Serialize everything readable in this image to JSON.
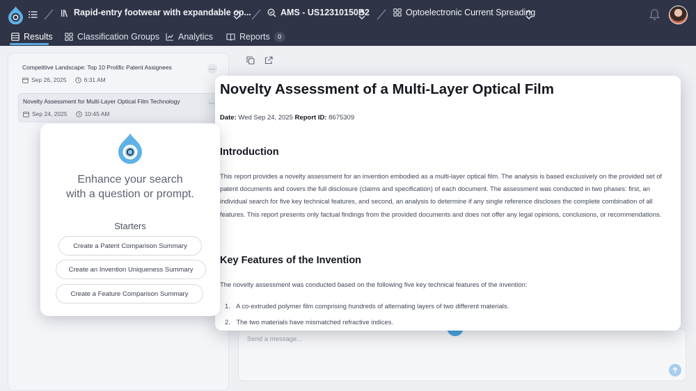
{
  "breadcrumbs": [
    {
      "label": "Rapid-entry footwear with expandable op..."
    },
    {
      "label": "AMS - US12310150B2"
    },
    {
      "label": "Optoelectronic Current Spreading"
    }
  ],
  "tabs": [
    {
      "label": "Results",
      "active": true
    },
    {
      "label": "Classification Groups"
    },
    {
      "label": "Analytics"
    },
    {
      "label": "Reports",
      "badge": "0"
    }
  ],
  "reports_list": [
    {
      "title": "Competitive Landscape: Top 10 Prolific Patent Assignees",
      "date": "Sep 26, 2025",
      "time": "6:31 AM"
    },
    {
      "title": "Novelty Assessment for Multi-Layer Optical Film Technology",
      "date": "Sep 24, 2025",
      "time": "10:45 AM",
      "selected": true
    }
  ],
  "starter_card": {
    "line1": "Enhance your search",
    "line2": "with a question or prompt.",
    "heading": "Starters",
    "buttons": [
      "Create a Patent Comparison Summary",
      "Create an Invention Uniqueness Summary",
      "Create a Feature Comparison Summary"
    ]
  },
  "report": {
    "title": "Novelty Assessment of a Multi-Layer Optical Film",
    "date_label": "Date:",
    "date_value": "Wed Sep 24, 2025",
    "id_label": "Report ID:",
    "id_value": "8675309",
    "intro_heading": "Introduction",
    "intro_text": "This report provides a novelty assessment for an invention embodied as a multi-layer optical film. The analysis is based exclusively on the provided set of patent documents and covers the full disclosure (claims and specification) of each document. The assessment was conducted in two phases: first, an individual search for five key technical features, and second, an analysis to determine if any single reference discloses the complete combination of all features. This report presents only factual findings from the provided documents and does not offer any legal opinions, conclusions, or recommendations.",
    "features_heading": "Key Features of the Invention",
    "features_intro": "The novelty assessment was conducted based on the following five key technical features of the invention:",
    "features": [
      {
        "num": "1.",
        "text": "A co-extruded polymer film comprising hundreds of alternating layers of two different materials."
      },
      {
        "num": "2.",
        "text": "The two materials have mismatched refractive indices."
      }
    ]
  },
  "message": {
    "placeholder": "Send a message..."
  },
  "colors": {
    "topbar": "#2f3446",
    "accent": "#5aa9e3",
    "page_bg": "#eef0f4"
  }
}
